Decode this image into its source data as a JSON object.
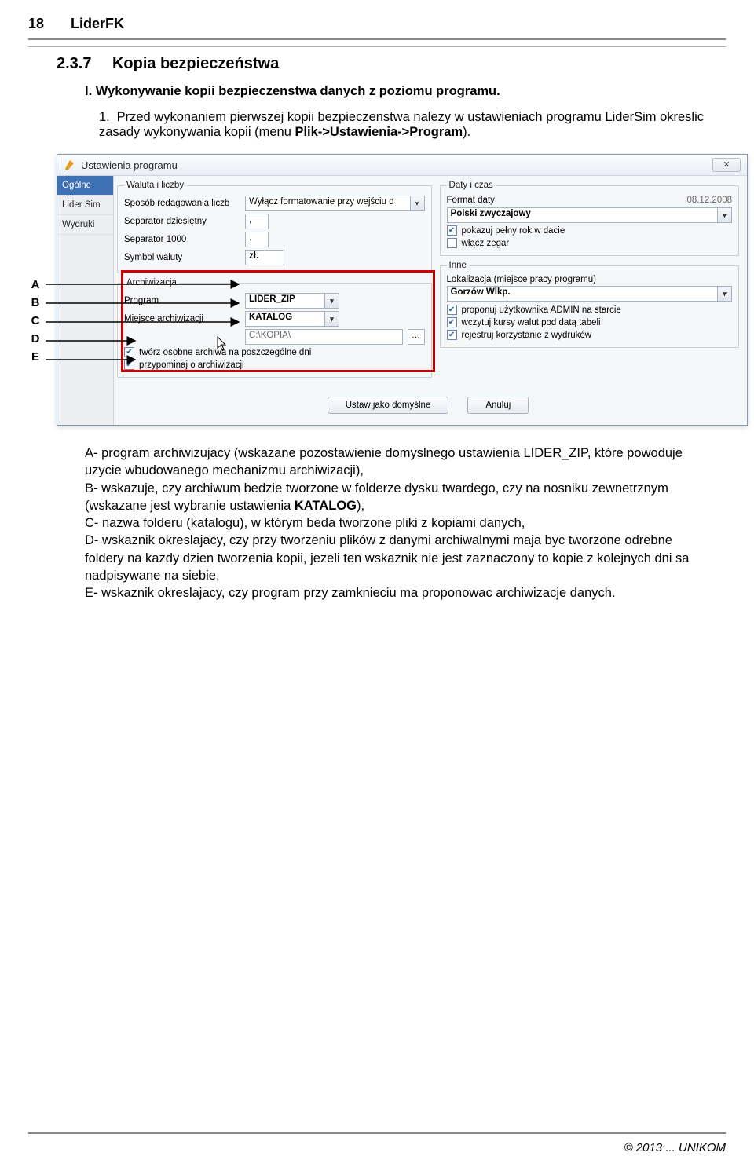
{
  "header": {
    "page_number": "18",
    "doc_title": "LiderFK"
  },
  "section": {
    "number": "2.3.7",
    "title": "Kopia bezpieczeństwa"
  },
  "intro": "I. Wykonywanie kopii bezpieczenstwa danych z poziomu programu.",
  "step1": {
    "num": "1.",
    "a": "Przed wykonaniem pierwszej kopii bezpieczenstwa nalezy w ustawieniach programu LiderSim okreslic zasady wykonywania kopii (menu ",
    "bold": "Plik->Ustawienia->Program",
    "b": ")."
  },
  "win": {
    "title": "Ustawienia programu",
    "close_glyph": "✕",
    "tabs": [
      "Ogólne",
      "Lider Sim",
      "Wydruki"
    ],
    "waluta_legend": "Waluta i liczby",
    "lbl_sposob": "Sposób redagowania liczb",
    "val_sposob": "Wyłącz formatowanie przy wejściu d",
    "lbl_sep_dz": "Separator dziesiętny",
    "val_sep_dz": ",",
    "lbl_sep_1000": "Separator 1000",
    "val_sep_1000": ".",
    "lbl_symbol": "Symbol waluty",
    "val_symbol": "zł.",
    "archiw_legend": "Archiwizacja",
    "lbl_program": "Program",
    "val_program": "LIDER_ZIP",
    "lbl_miejsce": "Miejsce archiwizacji",
    "val_miejsce": "KATALOG",
    "val_path": "C:\\KOPIA\\",
    "chk_osobne": "twórz osobne archiwa na poszczególne dni",
    "chk_przyp": "przypominaj o archiwizacji",
    "daty_legend": "Daty i czas",
    "lbl_format_daty": "Format daty",
    "val_format_daty": "08.12.2008",
    "val_format_sel": "Polski zwyczajowy",
    "chk_pelny_rok": "pokazuj pełny rok w dacie",
    "chk_zegar": "włącz zegar",
    "inne_legend": "Inne",
    "lbl_lokal": "Lokalizacja (miejsce pracy programu)",
    "val_lokal": "Gorzów Wlkp.",
    "chk_admin": "proponuj użytkownika ADMIN na starcie",
    "chk_kursy": "wczytuj kursy walut pod datą tabeli",
    "chk_rejestr": "rejestruj korzystanie z wydruków",
    "btn_default": "Ustaw jako domyślne",
    "btn_cancel": "Anuluj",
    "letters": [
      "A",
      "B",
      "C",
      "D",
      "E"
    ]
  },
  "legend": {
    "A_pre": "A-        program archiwizujacy (wskazane pozostawienie domyslnego ustawienia LIDER_ZIP, które powoduje uzycie wbudowanego mechanizmu archiwizacji),",
    "B_pre": "B-        wskazuje, czy archiwum bedzie tworzone w folderze dysku twardego, czy na nosniku zewnetrznym (wskazane jest wybranie ustawienia ",
    "B_bold": "KATALOG",
    "B_post": "),",
    "C": "C-        nazwa folderu (katalogu), w którym beda tworzone pliki z kopiami danych,",
    "D": "D-        wskaznik okreslajacy, czy przy tworzeniu plików z danymi archiwalnymi maja byc tworzone odrebne foldery na kazdy dzien tworzenia kopii, jezeli ten wskaznik nie jest zaznaczony to kopie z kolejnych dni sa nadpisywane na siebie,",
    "E": "E-        wskaznik okreslajacy, czy program przy zamknieciu ma proponowac archiwizacje danych."
  },
  "footer": "© 2013 ... UNIKOM"
}
